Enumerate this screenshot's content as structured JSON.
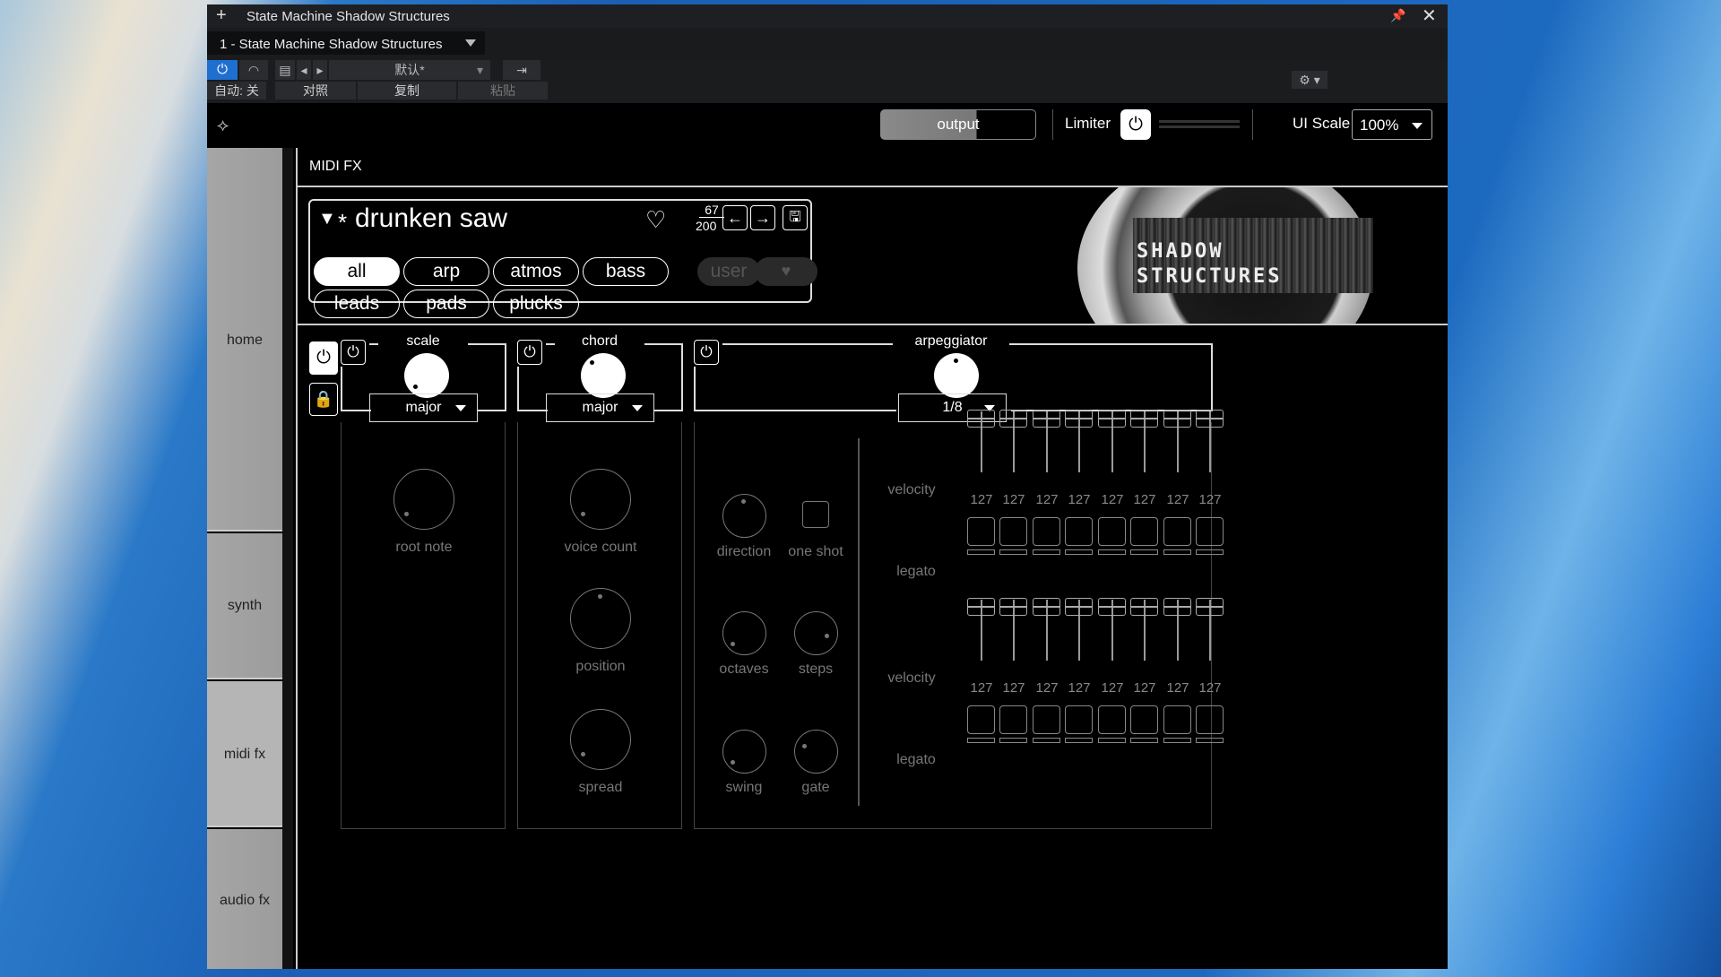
{
  "window": {
    "title": "State Machine Shadow Structures",
    "tab": "1 - State Machine Shadow Structures"
  },
  "toolbar": {
    "preset": "默认*",
    "auto": "自动: 关",
    "compare": "对照",
    "copy": "复制",
    "paste": "粘贴"
  },
  "header": {
    "output": "output",
    "limiter": "Limiter",
    "ui_scale_label": "UI Scale",
    "ui_scale": "100%"
  },
  "sidebar": {
    "items": [
      "home",
      "synth",
      "midi fx",
      "audio fx"
    ]
  },
  "page": {
    "title": "MIDI FX"
  },
  "preset": {
    "name": "drunken saw",
    "index": "67",
    "total": "200",
    "categories": [
      "all",
      "arp",
      "atmos",
      "bass",
      "leads",
      "pads",
      "plucks"
    ],
    "user": "user",
    "logo_text": "SHADOW STRUCTURES"
  },
  "scale": {
    "title": "scale",
    "mode": "major",
    "root_note": "root note"
  },
  "chord": {
    "title": "chord",
    "mode": "major",
    "voice_count": "voice count",
    "position": "position",
    "spread": "spread"
  },
  "arp": {
    "title": "arpeggiator",
    "rate": "1/8",
    "direction": "direction",
    "one_shot": "one shot",
    "octaves": "octaves",
    "steps": "steps",
    "swing": "swing",
    "gate": "gate",
    "velocity_label": "velocity",
    "legato_label": "legato",
    "row1_velocity": [
      "127",
      "127",
      "127",
      "127",
      "127",
      "127",
      "127",
      "127"
    ],
    "row2_velocity": [
      "127",
      "127",
      "127",
      "127",
      "127",
      "127",
      "127",
      "127"
    ]
  }
}
